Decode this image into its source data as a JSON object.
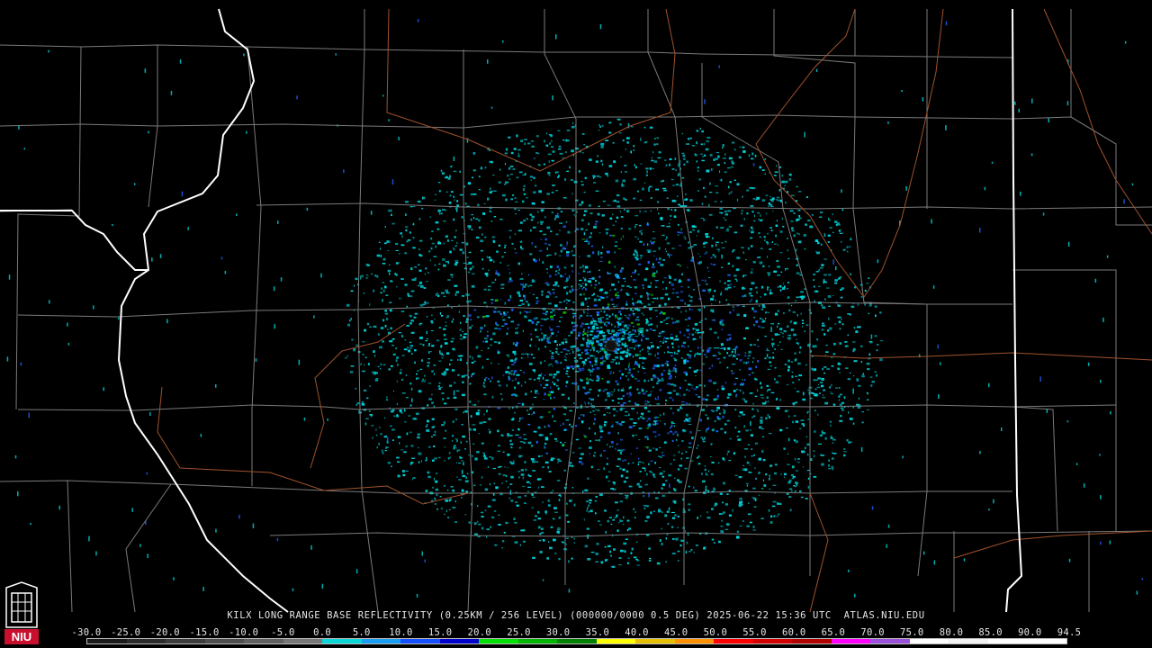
{
  "product": {
    "station": "KILX",
    "description": "LONG RANGE BASE REFLECTIVITY",
    "resolution": "(0.25KM / 256 LEVEL)",
    "volume": "(000000/0000 0.5 DEG)",
    "datetime": "2025-06-22 15:36 UTC",
    "source": "ATLAS.NIU.EDU"
  },
  "logo": {
    "text": "NIU",
    "color": "#c8102e"
  },
  "colors": {
    "background": "#000000",
    "county_border": "#7a7a7a",
    "state_border": "#ffffff",
    "river": "#a0522d",
    "radar_low": "#00d8e0",
    "radar_mid": "#1e64ff",
    "radar_high": "#12c400"
  },
  "color_scale": {
    "labels": [
      "-30.0",
      "-25.0",
      "-20.0",
      "-15.0",
      "-10.0",
      "-5.0",
      "0.0",
      "5.0",
      "10.0",
      "15.0",
      "20.0",
      "25.0",
      "30.0",
      "35.0",
      "40.0",
      "45.0",
      "50.0",
      "55.0",
      "60.0",
      "65.0",
      "70.0",
      "75.0",
      "80.0",
      "85.0",
      "90.0",
      "94.5"
    ],
    "colors": [
      "#1a1a1a",
      "#2b2b2b",
      "#3c3c3c",
      "#4e4e4e",
      "#606060",
      "#777777",
      "#0bd6d6",
      "#1a9cf0",
      "#1450ff",
      "#0000cc",
      "#00e000",
      "#00b400",
      "#008000",
      "#ffff00",
      "#e6c000",
      "#ff9000",
      "#ff0000",
      "#d40000",
      "#b00000",
      "#ff00ff",
      "#9a50d8",
      "#ffffff",
      "#f2f2f2",
      "#ffffff",
      "#ffffff"
    ]
  },
  "radar": {
    "site_name": "KILX",
    "shape": "ellipse"
  }
}
